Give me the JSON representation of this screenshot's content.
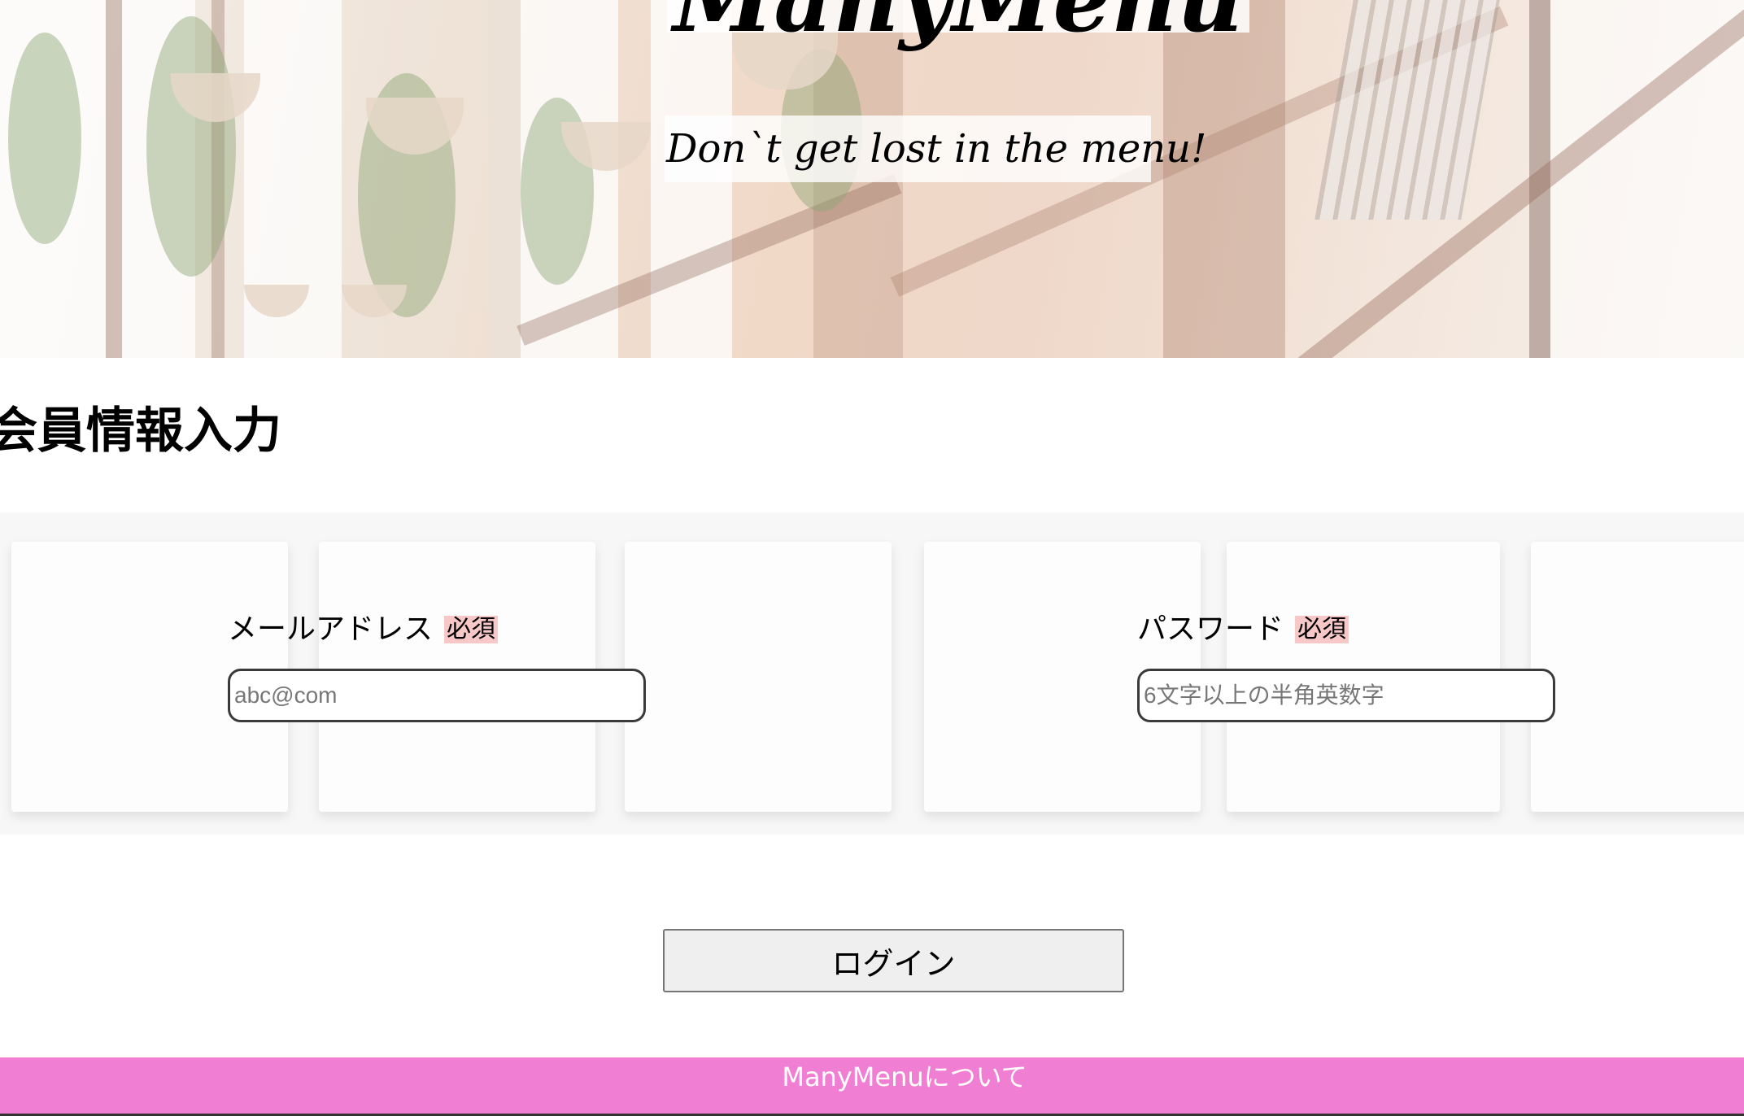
{
  "header": {
    "title": "ManyMenu",
    "tagline": "Don`t get lost in the menu!"
  },
  "form": {
    "heading": "会員情報入力",
    "email": {
      "label": "メールアドレス",
      "required": "必須",
      "placeholder": "abc@com",
      "value": ""
    },
    "password": {
      "label": "パスワード",
      "required": "必須",
      "placeholder": "6文字以上の半角英数字",
      "value": ""
    },
    "submit_label": "ログイン"
  },
  "footer": {
    "link_label": "ManyMenuについて",
    "background_color": "#f07fd4"
  },
  "colors": {
    "required_badge": "#f8c8c8",
    "button_bg": "#efefef"
  }
}
